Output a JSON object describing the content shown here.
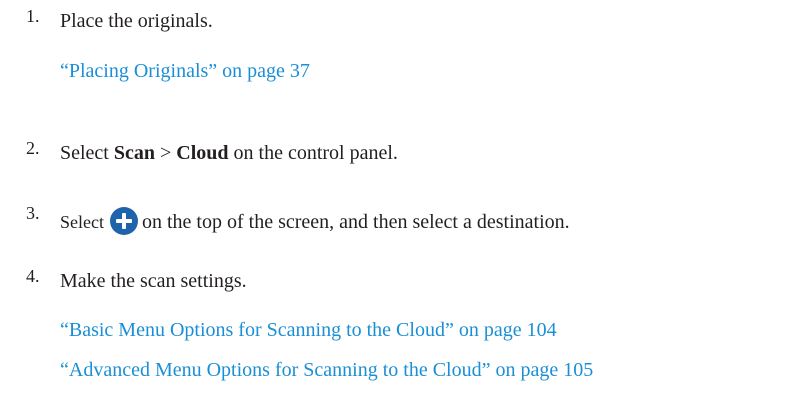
{
  "steps": [
    {
      "number": "1.",
      "text": "Place the originals.",
      "links": [
        "“Placing Originals” on page 37"
      ]
    },
    {
      "number": "2.",
      "pre": "Select ",
      "bold1": "Scan",
      "mid": " > ",
      "bold2": "Cloud",
      "post": " on the control panel."
    },
    {
      "number": "3.",
      "pre": "Select",
      "icon": "plus-circle-icon",
      "post": "on the top of the screen, and then select a destination."
    },
    {
      "number": "4.",
      "text": "Make the scan settings.",
      "links": [
        "“Basic Menu Options for Scanning to the Cloud” on page 104",
        "“Advanced Menu Options for Scanning to the Cloud” on page 105"
      ]
    }
  ],
  "colors": {
    "text": "#231f20",
    "link": "#1a8fd6",
    "icon": "#1f64ab"
  }
}
